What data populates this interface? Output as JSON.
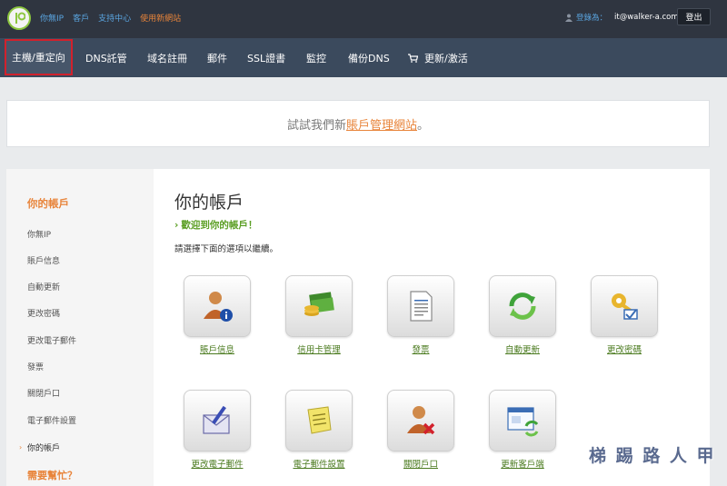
{
  "topbar": {
    "links": [
      "你無IP",
      "客戶",
      "支持中心"
    ],
    "new_site_link": "使用新網站",
    "login_label": "登錄為：",
    "user_email": "it@walker-a.com",
    "logout_label": "登出"
  },
  "nav": {
    "items": [
      "主機/重定向",
      "DNS託管",
      "域名註冊",
      "郵件",
      "SSL證書",
      "監控",
      "備份DNS",
      "更新/激活"
    ]
  },
  "banner": {
    "prefix": "試試我們新",
    "link": "賬戶管理網站",
    "suffix": "。"
  },
  "sidebar": {
    "title": "你的帳戶",
    "items": [
      "你無IP",
      "賬戶信息",
      "自動更新",
      "更改密碼",
      "更改電子郵件",
      "發票",
      "關閉戶口",
      "電子郵件設置",
      "你的帳戶"
    ],
    "help": "需要幫忙？"
  },
  "content": {
    "title": "你的帳戶",
    "welcome": "歡迎到你的帳戶！",
    "instruction": "請選擇下面的選項以繼續。",
    "tiles": [
      {
        "label": "賬戶信息",
        "icon": "user-info-icon"
      },
      {
        "label": "信用卡管理",
        "icon": "money-icon"
      },
      {
        "label": "發票",
        "icon": "invoice-icon"
      },
      {
        "label": "自動更新",
        "icon": "auto-renew-icon"
      },
      {
        "label": "更改密碼",
        "icon": "key-icon"
      },
      {
        "label": "更改電子郵件",
        "icon": "email-edit-icon"
      },
      {
        "label": "電子郵件設置",
        "icon": "note-icon"
      },
      {
        "label": "關閉戶口",
        "icon": "close-account-icon"
      },
      {
        "label": "更新客戶端",
        "icon": "update-client-icon"
      }
    ]
  },
  "watermark": "梯 踢 路 人 甲",
  "colors": {
    "accent": "#e8843a",
    "green": "#5c9f25",
    "nav": "#3b4a5d",
    "topbar": "#2f3540",
    "highlight": "#d2212c"
  }
}
